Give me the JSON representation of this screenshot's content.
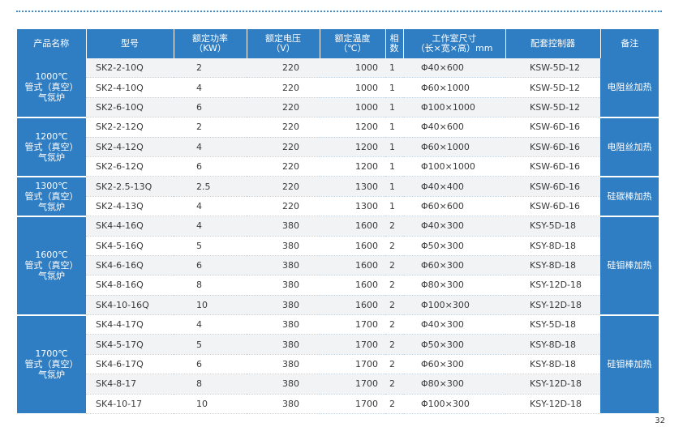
{
  "headers": {
    "category": "产品名称",
    "model": "型号",
    "power": [
      "额定功率",
      "（KW）"
    ],
    "voltage": [
      "额定电压",
      "（V）"
    ],
    "temperature": [
      "额定温度",
      "（℃）"
    ],
    "phase": [
      "相",
      "数"
    ],
    "chamber": [
      "工作室尺寸",
      "（长×宽×高）mm"
    ],
    "controller": "配套控制器",
    "note": "备注"
  },
  "groups": [
    {
      "category": [
        "1000℃",
        "管式（真空）",
        "气氛炉"
      ],
      "note": "电阻丝加热",
      "rows": [
        {
          "model": "SK2-2-10Q",
          "power": "2",
          "voltage": "220",
          "temperature": "1000",
          "phase": "1",
          "chamber": "Φ40×600",
          "controller": "KSW-5D-12"
        },
        {
          "model": "SK2-4-10Q",
          "power": "4",
          "voltage": "220",
          "temperature": "1000",
          "phase": "1",
          "chamber": "Φ60×1000",
          "controller": "KSW-5D-12"
        },
        {
          "model": "SK2-6-10Q",
          "power": "6",
          "voltage": "220",
          "temperature": "1000",
          "phase": "1",
          "chamber": "Φ100×1000",
          "controller": "KSW-5D-12"
        }
      ]
    },
    {
      "category": [
        "1200℃",
        "管式（真空）",
        "气氛炉"
      ],
      "note": "电阻丝加热",
      "rows": [
        {
          "model": "SK2-2-12Q",
          "power": "2",
          "voltage": "220",
          "temperature": "1200",
          "phase": "1",
          "chamber": "Φ40×600",
          "controller": "KSW-6D-16"
        },
        {
          "model": "SK2-4-12Q",
          "power": "4",
          "voltage": "220",
          "temperature": "1200",
          "phase": "1",
          "chamber": "Φ60×1000",
          "controller": "KSW-6D-16"
        },
        {
          "model": "SK2-6-12Q",
          "power": "6",
          "voltage": "220",
          "temperature": "1200",
          "phase": "1",
          "chamber": "Φ100×1000",
          "controller": "KSW-6D-16"
        }
      ]
    },
    {
      "category": [
        "1300℃",
        "管式（真空）",
        "气氛炉"
      ],
      "note": "硅碳棒加热",
      "rows": [
        {
          "model": "SK2-2.5-13Q",
          "power": "2.5",
          "voltage": "220",
          "temperature": "1300",
          "phase": "1",
          "chamber": "Φ40×400",
          "controller": "KSW-6D-16"
        },
        {
          "model": "SK2-4-13Q",
          "power": "4",
          "voltage": "220",
          "temperature": "1300",
          "phase": "1",
          "chamber": "Φ60×600",
          "controller": "KSW-6D-16"
        }
      ]
    },
    {
      "category": [
        "1600℃",
        "管式（真空）",
        "气氛炉"
      ],
      "note": "硅钼棒加热",
      "rows": [
        {
          "model": "SK4-4-16Q",
          "power": "4",
          "voltage": "380",
          "temperature": "1600",
          "phase": "2",
          "chamber": "Φ40×300",
          "controller": "KSY-5D-18"
        },
        {
          "model": "SK4-5-16Q",
          "power": "5",
          "voltage": "380",
          "temperature": "1600",
          "phase": "2",
          "chamber": "Φ50×300",
          "controller": "KSY-8D-18"
        },
        {
          "model": "SK4-6-16Q",
          "power": "6",
          "voltage": "380",
          "temperature": "1600",
          "phase": "2",
          "chamber": "Φ60×300",
          "controller": "KSY-8D-18"
        },
        {
          "model": "SK4-8-16Q",
          "power": "8",
          "voltage": "380",
          "temperature": "1600",
          "phase": "2",
          "chamber": "Φ80×300",
          "controller": "KSY-12D-18"
        },
        {
          "model": "SK4-10-16Q",
          "power": "10",
          "voltage": "380",
          "temperature": "1600",
          "phase": "2",
          "chamber": "Φ100×300",
          "controller": "KSY-12D-18"
        }
      ]
    },
    {
      "category": [
        "1700℃",
        "管式（真空）",
        "气氛炉"
      ],
      "note": "硅钼棒加热",
      "rows": [
        {
          "model": "SK4-4-17Q",
          "power": "4",
          "voltage": "380",
          "temperature": "1700",
          "phase": "2",
          "chamber": "Φ40×300",
          "controller": "KSY-5D-18"
        },
        {
          "model": "SK4-5-17Q",
          "power": "5",
          "voltage": "380",
          "temperature": "1700",
          "phase": "2",
          "chamber": "Φ50×300",
          "controller": "KSY-8D-18"
        },
        {
          "model": "SK4-6-17Q",
          "power": "6",
          "voltage": "380",
          "temperature": "1700",
          "phase": "2",
          "chamber": "Φ60×300",
          "controller": "KSY-8D-18"
        },
        {
          "model": "SK4-8-17",
          "power": "8",
          "voltage": "380",
          "temperature": "1700",
          "phase": "2",
          "chamber": "Φ80×300",
          "controller": "KSY-12D-18"
        },
        {
          "model": "SK4-10-17",
          "power": "10",
          "voltage": "380",
          "temperature": "1700",
          "phase": "2",
          "chamber": "Φ100×300",
          "controller": "KSY-12D-18"
        }
      ]
    }
  ],
  "page_number": "32",
  "colors": {
    "header_blue": "#2f7dc2",
    "stripe_gray": "#f2f3f5",
    "rule_blue": "#3f8fd0"
  }
}
